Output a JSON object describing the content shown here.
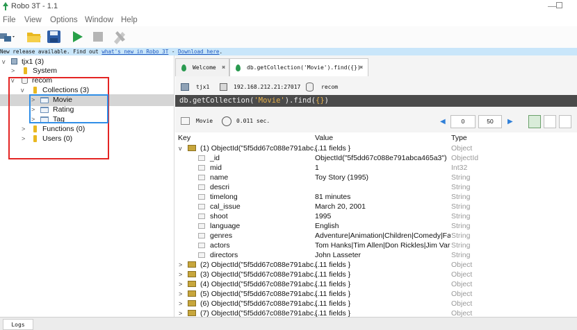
{
  "window": {
    "title": "Robo 3T - 1.1"
  },
  "menu": [
    "File",
    "View",
    "Options",
    "Window",
    "Help"
  ],
  "banner": {
    "text": "New release available. Find out ",
    "link1": "what's new in Robo 3T",
    "sep": " - ",
    "link2": "Download here",
    "end": "."
  },
  "tree": {
    "server": "tjx1 (3)",
    "system": "System",
    "db": "recom",
    "collections": "Collections (3)",
    "movie": "Movie",
    "rating": "Rating",
    "tag": "Tag",
    "functions": "Functions (0)",
    "users": "Users (0)"
  },
  "tabs": {
    "welcome": "Welcome",
    "query": "db.getCollection('Movie').find({})"
  },
  "connection": {
    "server": "tjx1",
    "address": "192.168.212.21:27017",
    "database": "recom"
  },
  "query": {
    "prefix": "db.getCollection(",
    "arg": "'Movie'",
    "mid": ").find(",
    "braces": "{}",
    "end": ")"
  },
  "result": {
    "collection": "Movie",
    "time": "0.011 sec.",
    "skip": "0",
    "limit": "50"
  },
  "columns": {
    "key": "Key",
    "value": "Value",
    "type": "Type"
  },
  "rows": [
    {
      "key": "(1) ObjectId(\"5f5dd67c088e791abc...",
      "value": "{ 11 fields }",
      "type": "Object"
    },
    {
      "key": "_id",
      "value": "ObjectId(\"5f5dd67c088e791abca465a3\")",
      "type": "ObjectId"
    },
    {
      "key": "mid",
      "value": "1",
      "type": "Int32"
    },
    {
      "key": "name",
      "value": "Toy Story (1995)",
      "type": "String"
    },
    {
      "key": "descri",
      "value": "",
      "type": "String"
    },
    {
      "key": "timelong",
      "value": "81 minutes",
      "type": "String"
    },
    {
      "key": "cal_issue",
      "value": "March 20, 2001",
      "type": "String"
    },
    {
      "key": "shoot",
      "value": "1995",
      "type": "String"
    },
    {
      "key": "language",
      "value": "English",
      "type": "String"
    },
    {
      "key": "genres",
      "value": "Adventure|Animation|Children|Comedy|Fa...",
      "type": "String"
    },
    {
      "key": "actors",
      "value": "Tom Hanks|Tim Allen|Don Rickles|Jim Varn...",
      "type": "String"
    },
    {
      "key": "directors",
      "value": "John Lasseter",
      "type": "String"
    },
    {
      "key": "(2) ObjectId(\"5f5dd67c088e791abc...",
      "value": "{ 11 fields }",
      "type": "Object"
    },
    {
      "key": "(3) ObjectId(\"5f5dd67c088e791abc...",
      "value": "{ 11 fields }",
      "type": "Object"
    },
    {
      "key": "(4) ObjectId(\"5f5dd67c088e791abc...",
      "value": "{ 11 fields }",
      "type": "Object"
    },
    {
      "key": "(5) ObjectId(\"5f5dd67c088e791abc...",
      "value": "{ 11 fields }",
      "type": "Object"
    },
    {
      "key": "(6) ObjectId(\"5f5dd67c088e791abc...",
      "value": "{ 11 fields }",
      "type": "Object"
    },
    {
      "key": "(7) ObjectId(\"5f5dd67c088e791abc...",
      "value": "{ 11 fields }",
      "type": "Object"
    }
  ],
  "logs": "Logs",
  "colors": {
    "banner": "#c9e6fa",
    "selection": "#d5d5d5",
    "red_highlight": "#e42423",
    "blue_highlight": "#2f8ee7",
    "query_bg": "#4a4a4a"
  }
}
